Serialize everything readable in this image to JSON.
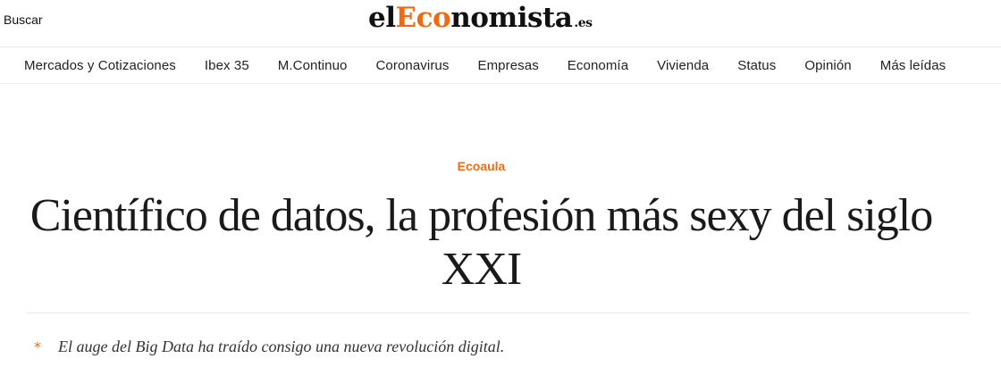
{
  "header": {
    "search_label": "Buscar",
    "logo": {
      "part1": "el",
      "part2_accent": "Eco",
      "part3": "nomista",
      "tld": ".es"
    }
  },
  "nav": {
    "items": [
      {
        "label": "Mercados y Cotizaciones"
      },
      {
        "label": "Ibex 35"
      },
      {
        "label": "M.Continuo"
      },
      {
        "label": "Coronavirus"
      },
      {
        "label": "Empresas"
      },
      {
        "label": "Economía"
      },
      {
        "label": "Vivienda"
      },
      {
        "label": "Status"
      },
      {
        "label": "Opinión"
      },
      {
        "label": "Más leídas"
      }
    ]
  },
  "article": {
    "section": "Ecoaula",
    "headline": "Científico de datos, la profesión más sexy del siglo XXI",
    "summary_bullet": "*",
    "summary": "El auge del Big Data ha traído consigo una nueva revolución digital."
  },
  "colors": {
    "accent": "#f26a10",
    "text": "#222222"
  }
}
